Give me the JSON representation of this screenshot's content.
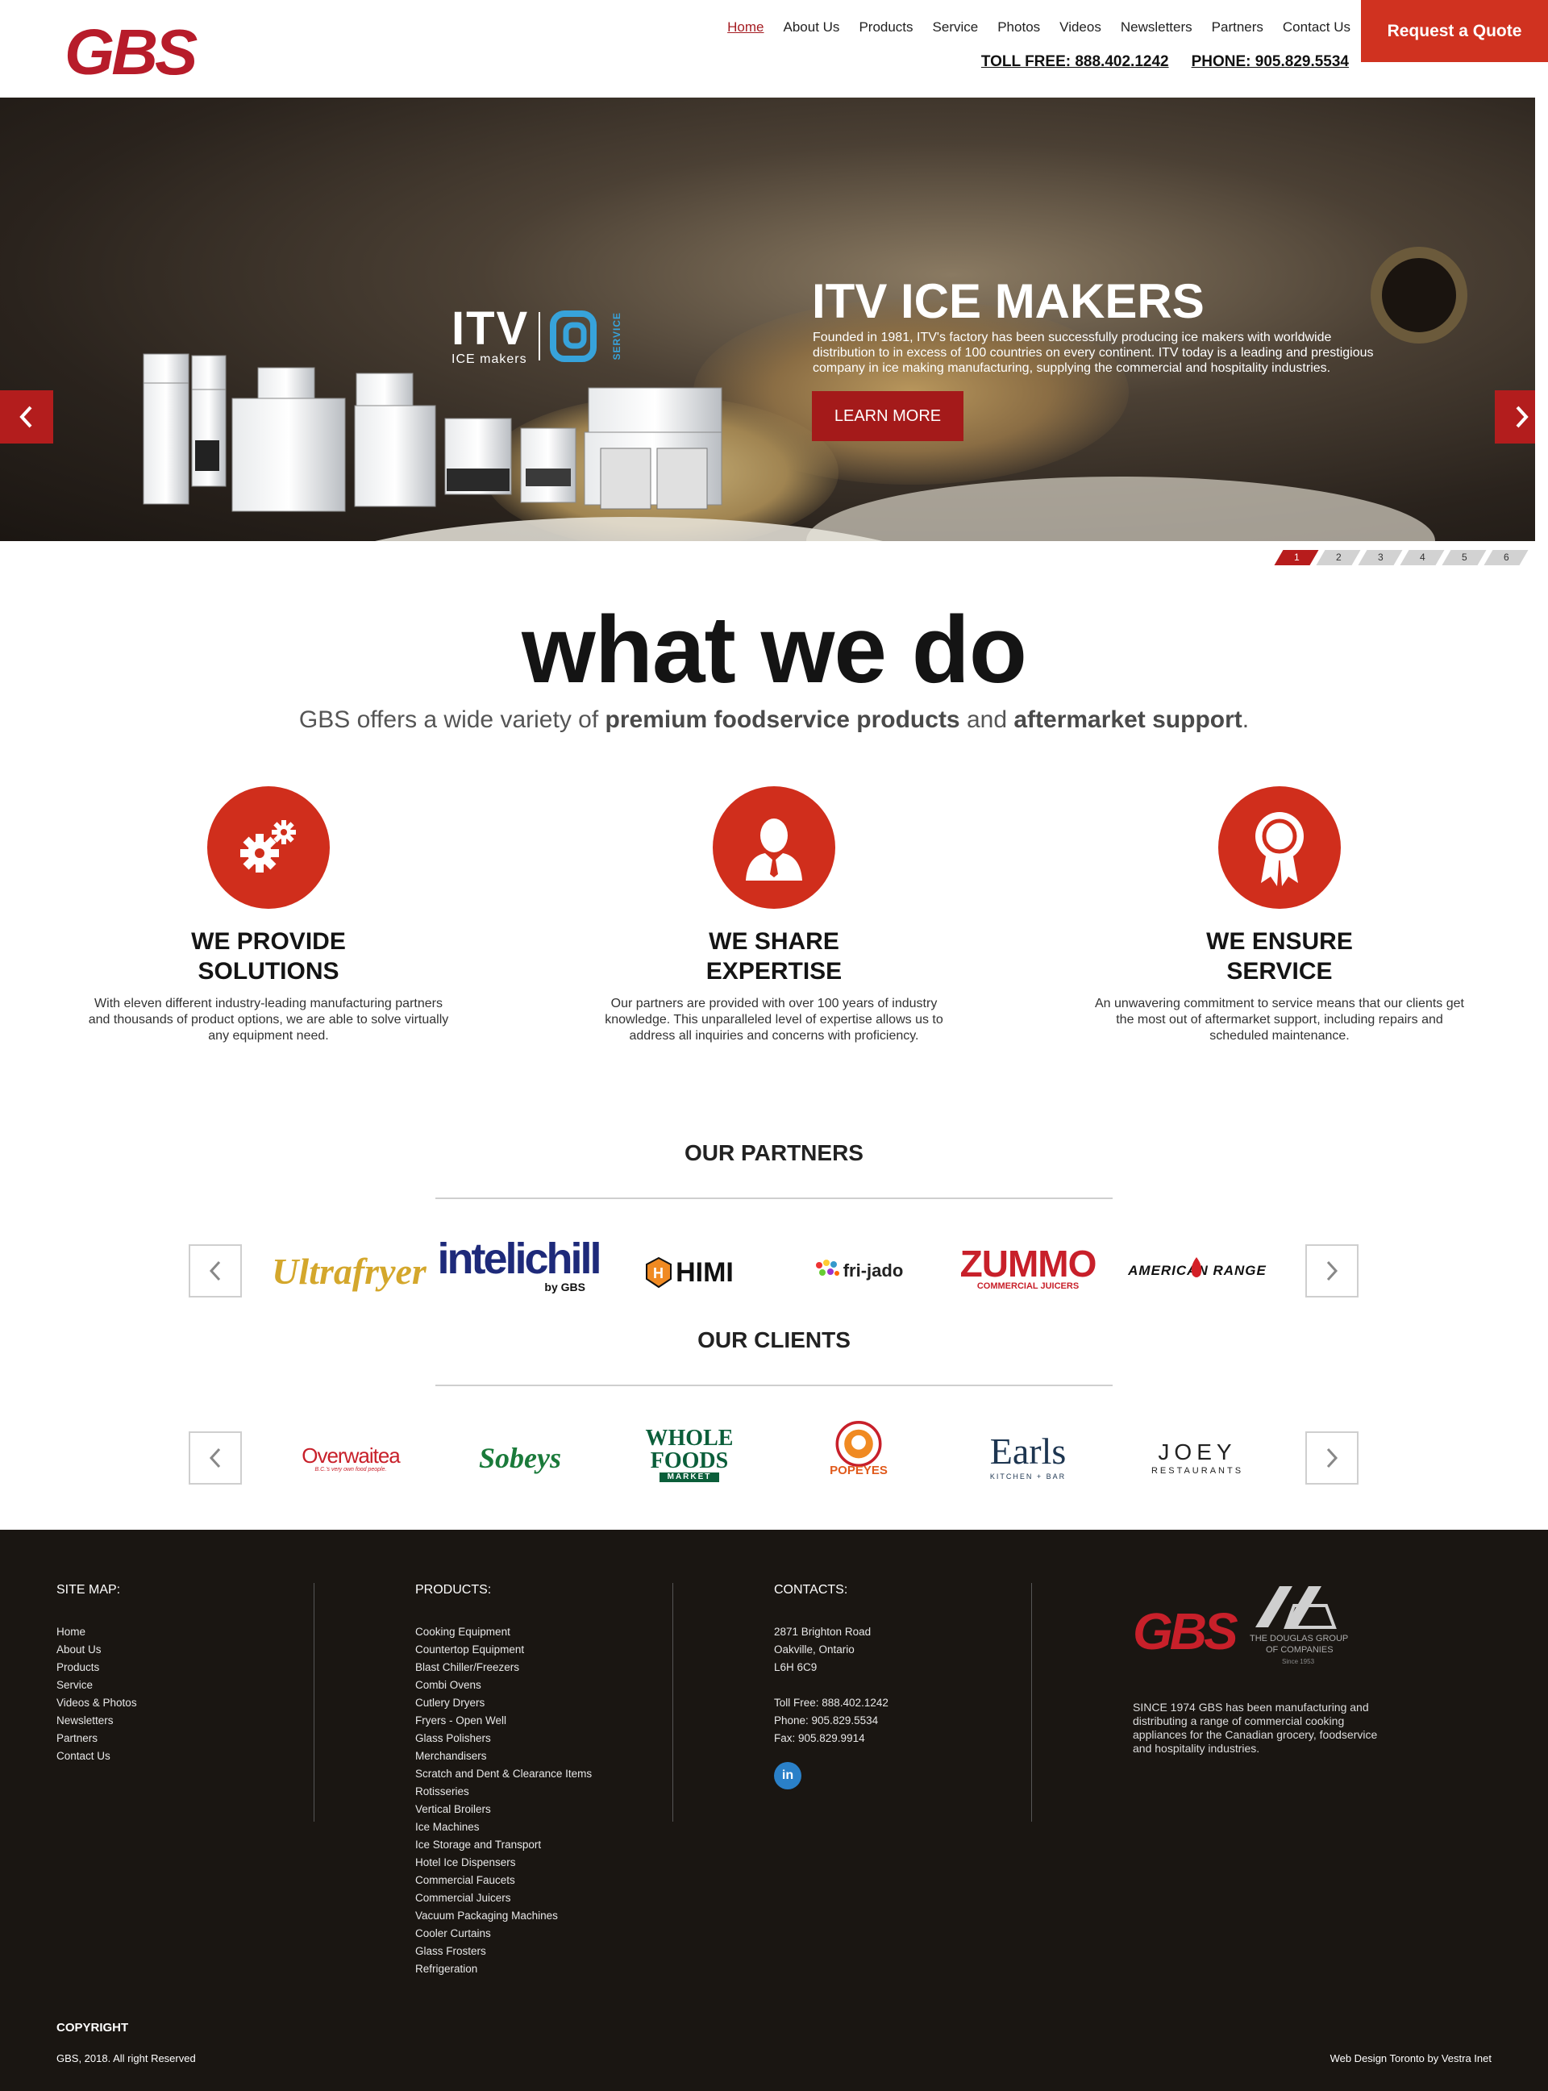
{
  "header": {
    "logo_text": "GBS",
    "nav": [
      "Home",
      "About Us",
      "Products",
      "Service",
      "Photos",
      "Videos",
      "Newsletters",
      "Partners",
      "Contact Us"
    ],
    "toll_free": "TOLL FREE: 888.402.1242",
    "phone": "PHONE: 905.829.5534",
    "quote_button": "Request a Quote",
    "colors": {
      "brand_red": "#d03220",
      "nav_active": "#a51c22"
    }
  },
  "hero": {
    "brand_logo_text": "ITV",
    "brand_logo_sub": "ICE makers",
    "brand_logo_service": "SERVICE",
    "title": "ITV ICE MAKERS",
    "text": "Founded in 1981, ITV's factory has been successfully producing ice makers with worldwide distribution to in excess of 100 countries on every continent. ITV today is a leading and prestigious company in ice making manufacturing, supplying the commercial and hospitality industries.",
    "button": "LEARN MORE",
    "prev_icon": "chevron-left-icon",
    "next_icon": "chevron-right-icon",
    "slides": [
      "1",
      "2",
      "3",
      "4",
      "5",
      "6"
    ],
    "active_slide": 1
  },
  "what_we_do": {
    "title": "what we do",
    "sub_prefix": "GBS offers a wide variety of ",
    "sub_bold1": "premium foodservice products",
    "sub_mid": " and ",
    "sub_bold2": "aftermarket support",
    "sub_suffix": ".",
    "features": [
      {
        "icon": "gears-icon",
        "title_line1": "WE PROVIDE",
        "title_line2": "SOLUTIONS",
        "text": "With eleven different industry-leading manufacturing partners and thousands of product options, we are able to solve virtually any equipment need."
      },
      {
        "icon": "expert-person-icon",
        "title_line1": "WE SHARE",
        "title_line2": "EXPERTISE",
        "text": "Our partners are provided with over 100 years of industry knowledge. This unparalleled level of expertise allows us to address all inquiries and concerns with proficiency."
      },
      {
        "icon": "award-ribbon-icon",
        "title_line1": "WE ENSURE",
        "title_line2": "SERVICE",
        "text": "An unwavering commitment to service means that our clients get the most out of aftermarket support, including repairs and scheduled maintenance."
      }
    ]
  },
  "partners": {
    "title": "OUR PARTNERS",
    "logos": [
      {
        "name": "Ultrafryer",
        "text": "Ultrafryer",
        "color": "#d4a72c"
      },
      {
        "name": "Intelichill",
        "text": "intelichill",
        "sub": "by GBS",
        "color": "#1e2a7a"
      },
      {
        "name": "HIMI",
        "text": "HIMI",
        "color": "#111111"
      },
      {
        "name": "Fri-jado",
        "text": "fri-jado",
        "color": "#222222"
      },
      {
        "name": "Zummo",
        "text": "ZUMMO",
        "sub": "COMMERCIAL JUICERS",
        "color": "#c8202a"
      },
      {
        "name": "American Range",
        "text": "AMERICAN RANGE",
        "color": "#111111"
      }
    ]
  },
  "clients": {
    "title": "OUR CLIENTS",
    "logos": [
      {
        "name": "Overwaitea",
        "text": "Overwaitea",
        "sub": "B.C.'s very own food people.",
        "color": "#c8202a"
      },
      {
        "name": "Sobeys",
        "text": "Sobeys",
        "color": "#1a7a3a"
      },
      {
        "name": "Whole Foods",
        "text": "WHOLE",
        "text2": "FOODS",
        "sub": "MARKET",
        "color": "#0b5e3a"
      },
      {
        "name": "Popeyes",
        "text": "POPEYES",
        "color": "#e05a1c"
      },
      {
        "name": "Earls",
        "text": "Earls",
        "sub": "KITCHEN + BAR",
        "color": "#1d3550"
      },
      {
        "name": "Joey",
        "text": "JOEY",
        "sub": "RESTAURANTS",
        "color": "#222222"
      }
    ]
  },
  "footer": {
    "sitemap_title": "SITE MAP:",
    "sitemap": [
      "Home",
      "About Us",
      "Products",
      "Service",
      "Videos & Photos",
      "Newsletters",
      "Partners",
      "Contact Us"
    ],
    "products_title": "PRODUCTS:",
    "products": [
      "Cooking Equipment",
      "Countertop Equipment",
      "Blast Chiller/Freezers",
      "Combi Ovens",
      "Cutlery Dryers",
      "Fryers - Open Well",
      "Glass Polishers",
      "Merchandisers",
      "Scratch and Dent & Clearance Items",
      "Rotisseries",
      "Vertical Broilers",
      "Ice Machines",
      "Ice Storage and Transport",
      "Hotel Ice Dispensers",
      "Commercial Faucets",
      "Commercial Juicers",
      "Vacuum Packaging Machines",
      "Cooler Curtains",
      "Glass Frosters",
      "Refrigeration"
    ],
    "contacts_title": "CONTACTS:",
    "address": [
      "2871 Brighton Road",
      "Oakville, Ontario",
      "L6H 6C9"
    ],
    "phones": [
      "Toll Free: 888.402.1242",
      "Phone: 905.829.5534",
      "Fax: 905.829.9914"
    ],
    "linkedin": "in",
    "douglas_group_line1": "THE DOUGLAS GROUP",
    "douglas_group_line2": "OF COMPANIES",
    "douglas_group_since": "Since 1953",
    "about": "SINCE 1974 GBS has been manufacturing and distributing a range of commercial cooking appliances for the Canadian grocery, foodservice and hospitality industries.",
    "copyright_title": "COPYRIGHT",
    "copyright_text": "GBS, 2018. All right Reserved",
    "credit": "Web Design Toronto by Vestra Inet"
  }
}
